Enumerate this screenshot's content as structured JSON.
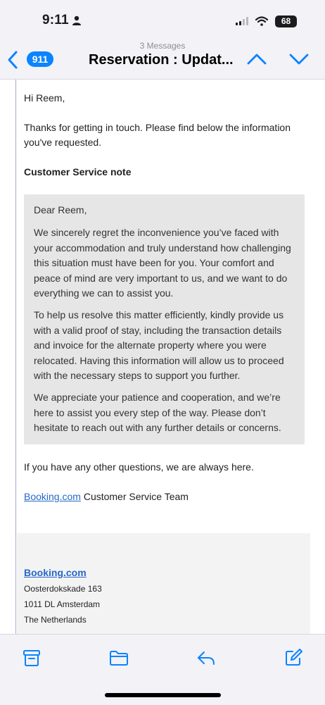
{
  "status": {
    "time": "9:11",
    "battery": "68"
  },
  "nav": {
    "back_count": "911",
    "message_count": "3 Messages",
    "title": "Reservation : Updat..."
  },
  "email": {
    "greeting": "Hi Reem,",
    "intro": "Thanks for getting in touch. Please find below the information you've requested.",
    "note_heading": "Customer Service note",
    "note": {
      "salutation": "Dear Reem,",
      "p1": "We sincerely regret the inconvenience you’ve faced with your accommodation and truly understand how challenging this situation must have been for you. Your comfort and peace of mind are very important to us, and we want to do everything we can to assist you.",
      "p2": "To help us resolve this matter efficiently, kindly provide us with a valid proof of stay, including the transaction details and invoice for the alternate property where you were relocated. Having this information will allow us to proceed with the necessary steps to support you further.",
      "p3": "We appreciate your patience and cooperation, and we’re here to assist you every step of the way. Please don’t hesitate to reach out with any further details or concerns."
    },
    "closing": "If you have any other questions, we are always here.",
    "signature_link": "Booking.com",
    "signature_rest": " Customer Service Team",
    "footer": {
      "brand": "Booking.com",
      "address_line1": "Oosterdokskade 163",
      "address_line2": "1011 DL Amsterdam",
      "address_line3": "The Netherlands"
    }
  },
  "toolbar": {
    "icons": [
      "archive-icon",
      "folder-icon",
      "reply-icon",
      "compose-icon"
    ]
  },
  "colors": {
    "accent": "#0a84ff",
    "link": "#2568c9",
    "note_bg": "#e6e6e6"
  }
}
